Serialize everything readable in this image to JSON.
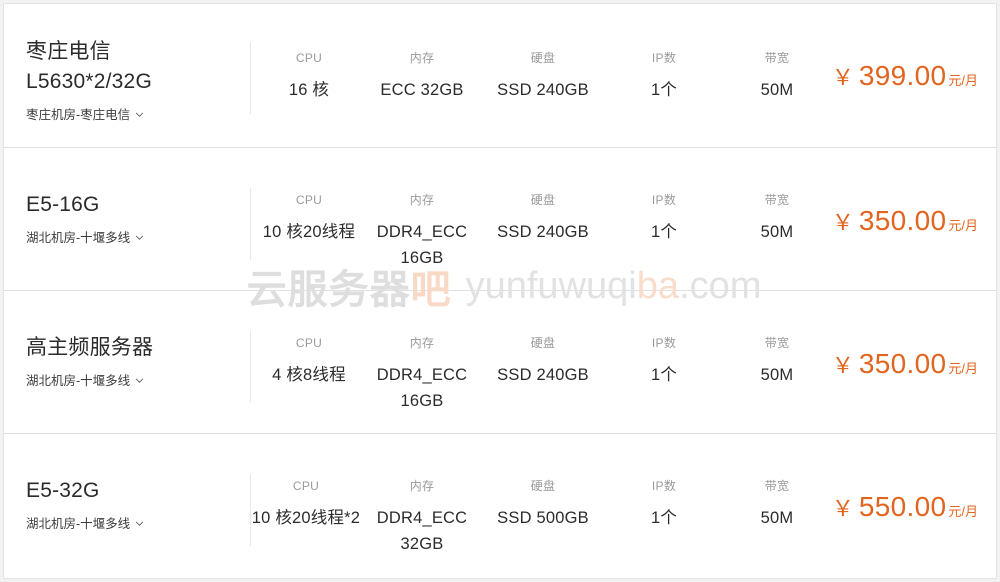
{
  "watermark": {
    "cn_prefix": "云服务器",
    "cn_accent": "吧",
    "latin_prefix": "yunfuwuqi",
    "latin_accent": "ba",
    "latin_suffix": ".com",
    "accent_color": "#f0b795"
  },
  "colors": {
    "price": "#e2651f",
    "card_bg": "#ffffff",
    "page_bg": "#f2f2f2",
    "divider": "#e0e0e0",
    "label": "#9a9a9a",
    "value": "#2b2b2b"
  },
  "spec_labels": {
    "cpu": "CPU",
    "memory": "内存",
    "disk": "硬盘",
    "ip": "IP数",
    "bandwidth": "带宽"
  },
  "currency_symbol": "￥",
  "price_unit": "元/月",
  "rows": [
    {
      "title_line1": "枣庄电信",
      "title_line2": "L5630*2/32G",
      "region": "枣庄机房-枣庄电信",
      "cpu": "16 核",
      "memory": "ECC 32GB",
      "disk": "SSD 240GB",
      "ip": "1个",
      "bandwidth": "50M",
      "price": "399.00"
    },
    {
      "title_line1": "E5-16G",
      "title_line2": "",
      "region": "湖北机房-十堰多线",
      "cpu": "10 核20线程",
      "memory": "DDR4_ECC 16GB",
      "disk": "SSD 240GB",
      "ip": "1个",
      "bandwidth": "50M",
      "price": "350.00"
    },
    {
      "title_line1": "高主频服务器",
      "title_line2": "",
      "region": "湖北机房-十堰多线",
      "cpu": "4 核8线程",
      "memory": "DDR4_ECC 16GB",
      "disk": "SSD 240GB",
      "ip": "1个",
      "bandwidth": "50M",
      "price": "350.00"
    },
    {
      "title_line1": "E5-32G",
      "title_line2": "",
      "region": "湖北机房-十堰多线",
      "cpu": "10 核20线程*2",
      "memory": "DDR4_ECC 32GB",
      "disk": "SSD 500GB",
      "ip": "1个",
      "bandwidth": "50M",
      "price": "550.00"
    }
  ]
}
